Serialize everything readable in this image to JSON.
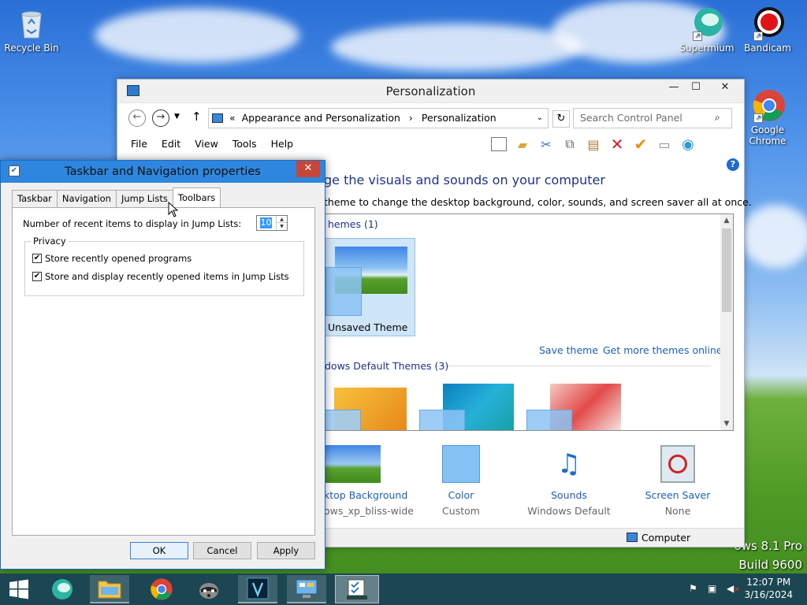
{
  "desktop": {
    "icons": [
      {
        "label": "Recycle Bin"
      },
      {
        "label": "Supermium"
      },
      {
        "label": "Bandicam"
      },
      {
        "label": "Google Chrome"
      }
    ],
    "watermark_line1": "ows 8.1 Pro",
    "watermark_line2": "Build 9600"
  },
  "control_panel": {
    "title": "Personalization",
    "breadcrumb_prefix": "«",
    "breadcrumb_1": "Appearance and Personalization",
    "breadcrumb_sep": "›",
    "breadcrumb_2": "Personalization",
    "search_placeholder": "Search Control Panel",
    "menu": [
      "File",
      "Edit",
      "View",
      "Tools",
      "Help"
    ],
    "heading": "ge the visuals and sounds on your computer",
    "subheading": "theme to change the desktop background, color, sounds, and screen saver all at once.",
    "my_themes_title": "hemes (1)",
    "unsaved_theme_label": "Unsaved Theme",
    "save_theme_link": "Save theme",
    "get_more_link": "Get more themes online",
    "default_themes_title": "dows Default Themes (3)",
    "bottom_items": [
      {
        "label": "ktop Background",
        "sub": "ows_xp_bliss-wide"
      },
      {
        "label": "Color",
        "sub": "Custom"
      },
      {
        "label": "Sounds",
        "sub": "Windows Default"
      },
      {
        "label": "Screen Saver",
        "sub": "None"
      }
    ],
    "status_computer": "Computer"
  },
  "dialog": {
    "title": "Taskbar and Navigation properties",
    "tabs": [
      "Taskbar",
      "Navigation",
      "Jump Lists",
      "Toolbars"
    ],
    "recent_items_label": "Number of recent items to display in Jump Lists:",
    "recent_items_value": "10",
    "privacy_group": "Privacy",
    "checkbox_1": "Store recently opened programs",
    "checkbox_2": "Store and display recently opened items in Jump Lists",
    "ok": "OK",
    "cancel": "Cancel",
    "apply": "Apply"
  },
  "taskbar": {
    "time": "12:07 PM",
    "date": "3/16/2024"
  },
  "colors": {
    "accent": "#2e86de",
    "link": "#1d5fb8",
    "heading": "#1e3287"
  }
}
